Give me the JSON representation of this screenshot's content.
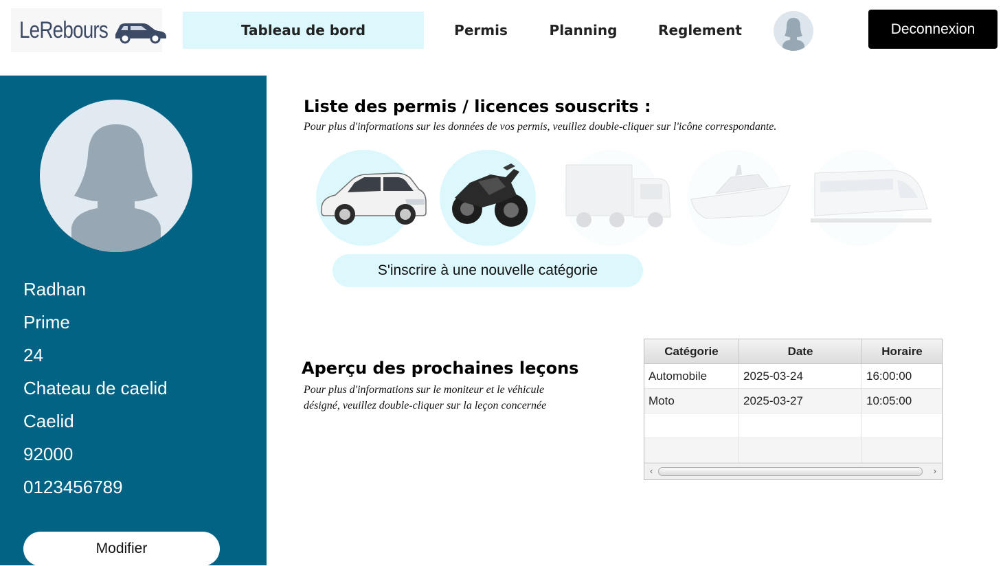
{
  "app": {
    "logo_text": "LeRebours"
  },
  "nav": {
    "items": [
      {
        "label": "Tableau de bord",
        "active": true
      },
      {
        "label": "Permis",
        "active": false
      },
      {
        "label": "Planning",
        "active": false
      },
      {
        "label": "Reglement",
        "active": false
      }
    ],
    "logout_label": "Deconnexion"
  },
  "profile": {
    "first_name": "Radhan",
    "last_name": "Prime",
    "age": "24",
    "address": "Chateau de caelid",
    "city": "Caelid",
    "postal_code": "92000",
    "phone": "0123456789",
    "edit_label": "Modifier"
  },
  "licenses": {
    "title": "Liste des permis / licences souscrits :",
    "description": "Pour plus d'informations sur les données de vos permis, veuillez double-cliquer sur l'icône correspondante.",
    "items": [
      {
        "icon": "car-icon",
        "subscribed": true
      },
      {
        "icon": "motorcycle-icon",
        "subscribed": true
      },
      {
        "icon": "truck-icon",
        "subscribed": false
      },
      {
        "icon": "boat-icon",
        "subscribed": false
      },
      {
        "icon": "train-icon",
        "subscribed": false
      }
    ],
    "new_category_label": "S'inscrire à une nouvelle catégorie"
  },
  "lessons": {
    "title": "Aperçu des prochaines leçons",
    "description": "Pour plus d'informations sur le moniteur et le véhicule désigné, veuillez double-cliquer sur la leçon concernée",
    "columns": [
      "Catégorie",
      "Date",
      "Horaire"
    ],
    "rows": [
      [
        "Automobile",
        "2025-03-24",
        "16:00:00"
      ],
      [
        "Moto",
        "2025-03-27",
        "10:05:00"
      ],
      [
        "",
        "",
        ""
      ],
      [
        "",
        "",
        ""
      ]
    ]
  },
  "colors": {
    "sidebar": "#036385",
    "accent_light": "#dcf8fc",
    "logout_bg": "#000000"
  }
}
